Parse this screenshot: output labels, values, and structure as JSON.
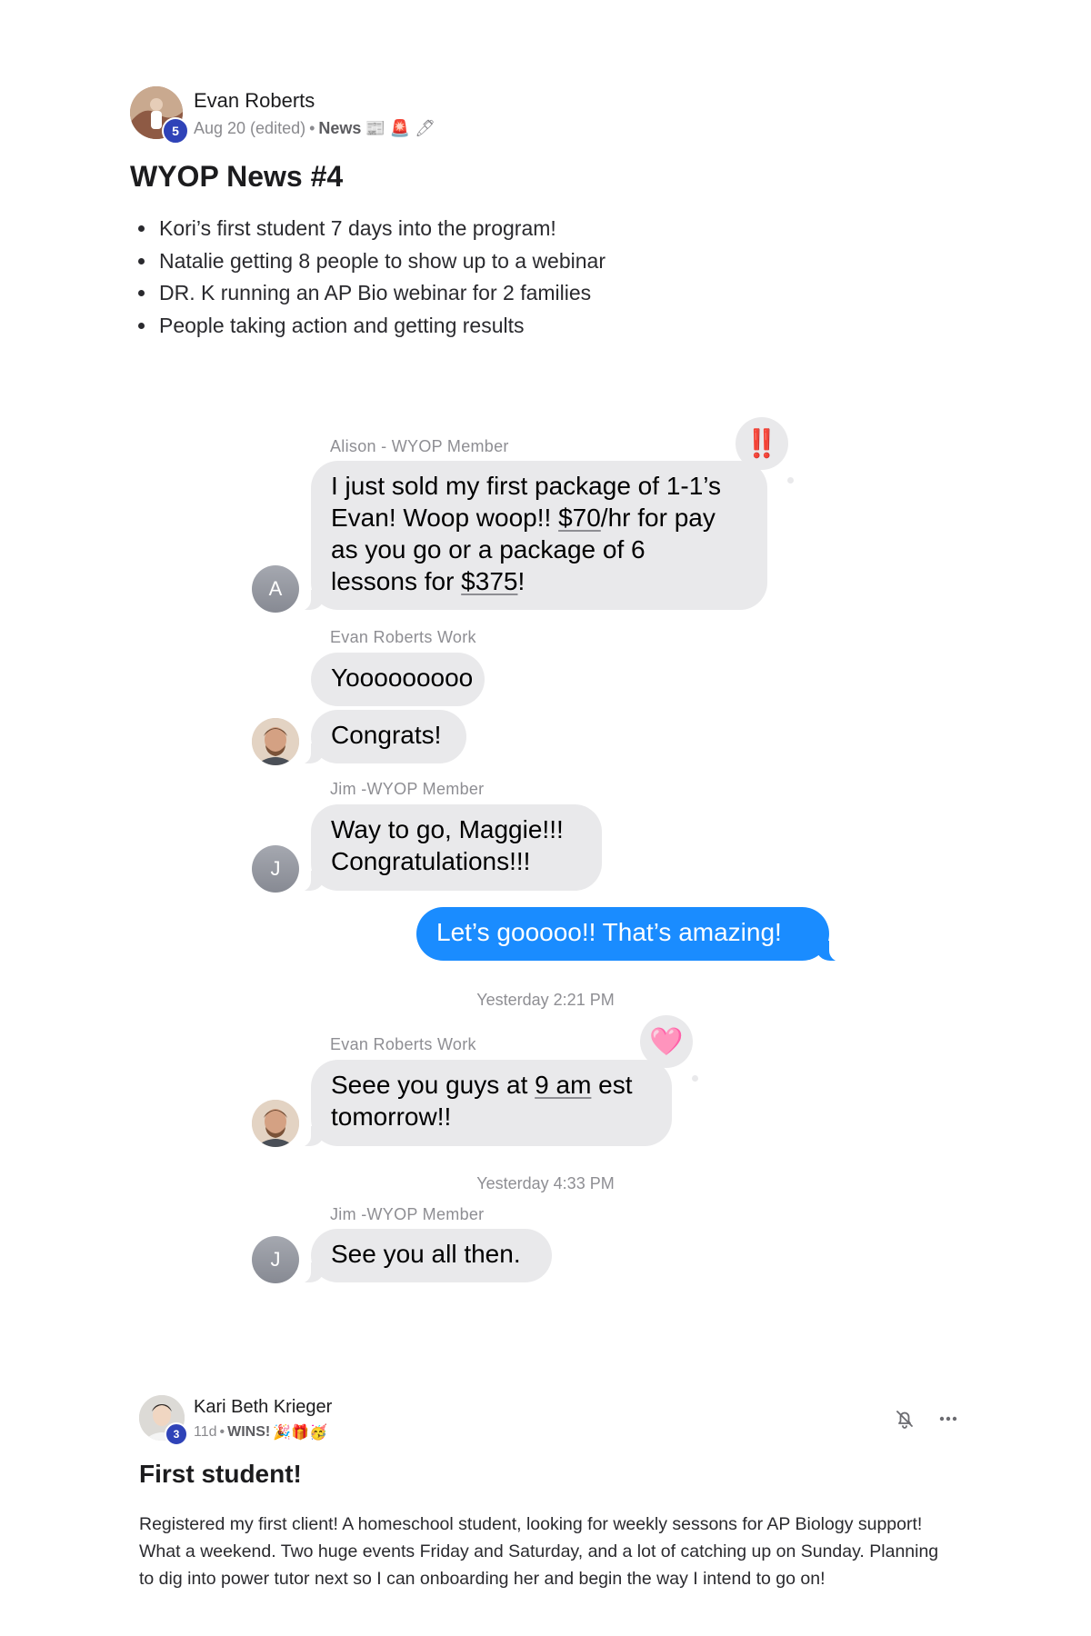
{
  "post1": {
    "author": "Evan Roberts",
    "level": "5",
    "date": "Aug 20 (edited)",
    "separator": "•",
    "category": "News",
    "category_emojis": "📰 🚨 🖊",
    "title": "WYOP News #4",
    "bullets": [
      "Kori’s first student 7 days into the program!",
      "Natalie getting 8 people to show up to a webinar",
      "DR. K running an AP Bio webinar for 2 families",
      "People taking action and getting results"
    ]
  },
  "chat": {
    "msg1": {
      "sender": "Alison - WYOP Member",
      "avatar_letter": "A",
      "reaction": "‼️",
      "lines": {
        "l1": "I just sold my first package of 1-1’s",
        "l2a": "Evan! Woop woop!! ",
        "l2b": "$70",
        "l2c": "/hr for pay",
        "l3": "as you go or a package of 6",
        "l4a": "lessons for ",
        "l4b": "$375",
        "l4c": "!"
      }
    },
    "msg2": {
      "sender": "Evan Roberts Work",
      "bubble1": "Yooooooooo",
      "bubble2": "Congrats!"
    },
    "msg3": {
      "sender": "Jim -WYOP Member",
      "avatar_letter": "J",
      "l1": "Way to go, Maggie!!!",
      "l2": "Congratulations!!!"
    },
    "msg4_outgoing": "Let’s gooooo!!  That’s amazing!",
    "timestamp1": "Yesterday 2:21 PM",
    "msg5": {
      "sender": "Evan Roberts Work",
      "reaction": "🩷",
      "l1a": "Seee you guys at ",
      "l1b": "9 am",
      "l1c": " est",
      "l2": "tomorrow!!"
    },
    "timestamp2": "Yesterday 4:33 PM",
    "msg6": {
      "sender": "Jim -WYOP Member",
      "avatar_letter": "J",
      "text": "See you all then."
    }
  },
  "post2": {
    "author": "Kari Beth Krieger",
    "level": "3",
    "age": "11d",
    "separator": "•",
    "category": "WINS!",
    "category_emojis": "🎉🎁🥳",
    "title": "First student!",
    "body_lines": [
      "Registered my first client! A homeschool student, looking for weekly sessons for AP Biology support!",
      "What a weekend. Two huge events Friday and Saturday, and a lot of catching up on Sunday. Planning",
      "to dig into power tutor next so I can onboarding her and begin the way I intend to go on!"
    ]
  }
}
